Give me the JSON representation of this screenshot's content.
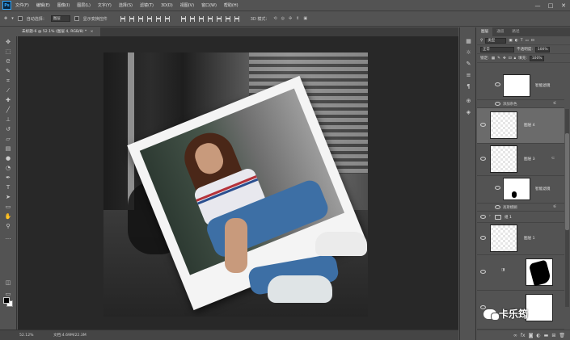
{
  "menubar": {
    "logo": "Ps",
    "items": [
      "文件(F)",
      "编辑(E)",
      "图像(I)",
      "图层(L)",
      "文字(Y)",
      "选择(S)",
      "滤镜(T)",
      "3D(D)",
      "视图(V)",
      "窗口(W)",
      "帮助(H)"
    ],
    "window_controls": [
      "—",
      "□",
      "✕"
    ]
  },
  "options_bar": {
    "auto_select_label": "自动选择：",
    "auto_select_value": "图层",
    "transform_controls_label": "显示变换控件",
    "mode_3d_label": "3D 模式："
  },
  "document_tab": {
    "title": "未标题-6 @ 52.1% (图层 4, RGB/8) *",
    "close": "×"
  },
  "status_bar": {
    "zoom": "52.12%",
    "doc_info": "文档:4.69M/22.3M"
  },
  "layers_panel": {
    "tabs": [
      "图层",
      "通道",
      "路径"
    ],
    "active_tab": "图层",
    "filter_kind": "类型",
    "blend_mode": "正常",
    "opacity_label": "不透明度:",
    "opacity_value": "100%",
    "lock_label": "锁定:",
    "fill_label": "填充:",
    "fill_value": "100%",
    "layers": [
      {
        "name": "智能滤镜",
        "thumb": "white"
      },
      {
        "name": "添加杂色",
        "thumb": "none"
      },
      {
        "name": "图层 4",
        "thumb": "transparent",
        "selected": true
      },
      {
        "name": "图层 3",
        "thumb": "transparent"
      },
      {
        "name": "智能滤镜",
        "thumb": "mask"
      },
      {
        "name": "高斯模糊",
        "thumb": "none"
      },
      {
        "name": "组 1",
        "thumb": "folder"
      },
      {
        "name": "图层 1",
        "thumb": "transparent"
      },
      {
        "name": "",
        "thumb": "black-shape"
      }
    ]
  },
  "watermark": {
    "text": "卡乐筠"
  },
  "colors": {
    "ui_dark": "#535353",
    "canvas_bg": "#282828",
    "accent_blue": "#31a8ff",
    "foreground": "#000000",
    "background": "#ffffff"
  }
}
